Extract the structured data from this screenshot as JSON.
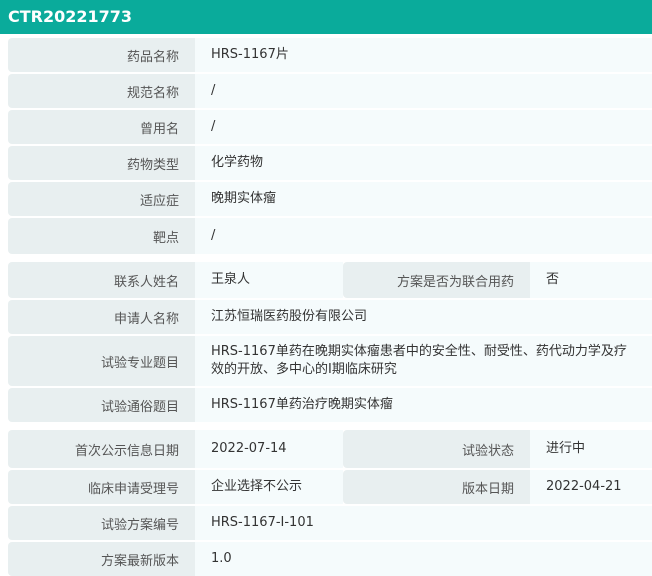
{
  "title": "CTR20221773",
  "group1": [
    {
      "label": "药品名称",
      "value": "HRS-1167片"
    },
    {
      "label": "规范名称",
      "value": "/"
    },
    {
      "label": "曾用名",
      "value": "/"
    },
    {
      "label": "药物类型",
      "value": "化学药物"
    },
    {
      "label": "适应症",
      "value": "晚期实体瘤"
    },
    {
      "label": "靶点",
      "value": "/"
    }
  ],
  "group2": {
    "contact_label": "联系人姓名",
    "contact_value": "王泉人",
    "combo_label": "方案是否为联合用药",
    "combo_value": "否",
    "rows": [
      {
        "label": "申请人名称",
        "value": "江苏恒瑞医药股份有限公司"
      },
      {
        "label": "试验专业题目",
        "value": "HRS-1167单药在晚期实体瘤患者中的安全性、耐受性、药代动力学及疗效的开放、多中心的I期临床研究"
      },
      {
        "label": "试验通俗题目",
        "value": "HRS-1167单药治疗晚期实体瘤"
      }
    ]
  },
  "group3": {
    "first_pub_label": "首次公示信息日期",
    "first_pub_value": "2022-07-14",
    "status_label": "试验状态",
    "status_value": "进行中",
    "accept_label": "临床申请受理号",
    "accept_value": "企业选择不公示",
    "version_date_label": "版本日期",
    "version_date_value": "2022-04-21",
    "rows": [
      {
        "label": "试验方案编号",
        "value": "HRS-1167-I-101"
      },
      {
        "label": "方案最新版本",
        "value": "1.0"
      }
    ]
  }
}
